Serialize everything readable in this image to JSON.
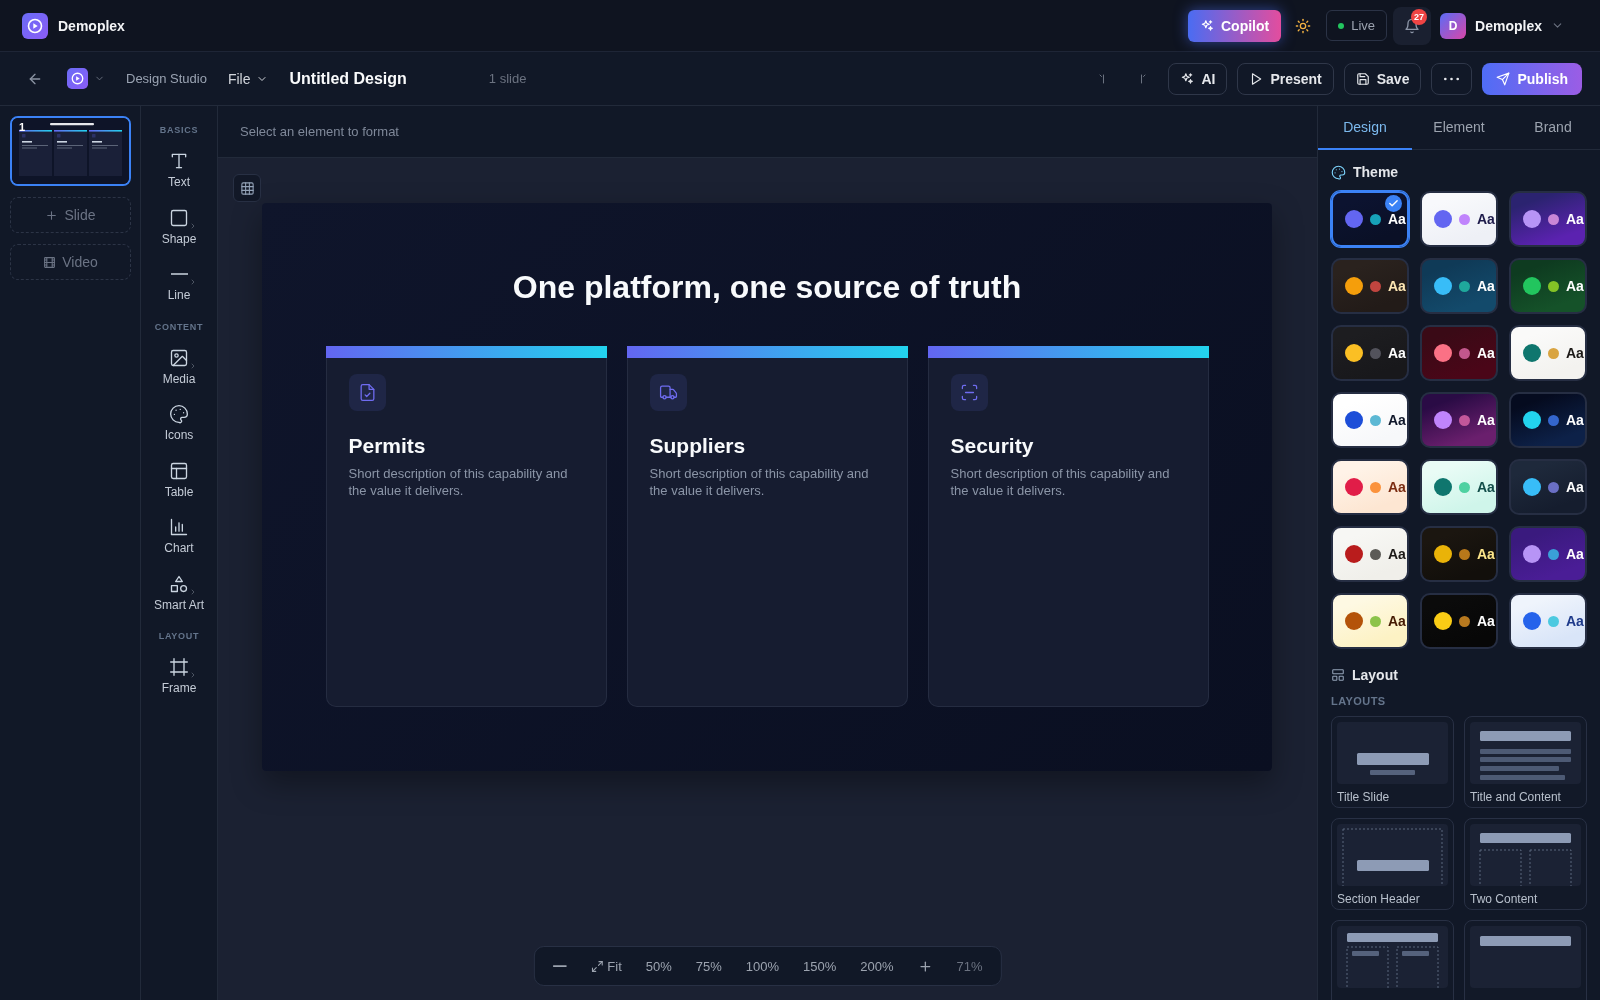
{
  "app": {
    "name": "Demoplex"
  },
  "header": {
    "copilot": "Copilot",
    "status": "Live",
    "notifications": "27",
    "user": {
      "initial": "D",
      "name": "Demoplex"
    }
  },
  "toolbar": {
    "breadcrumb": "Design Studio",
    "file_menu": "File",
    "document_title": "Untitled Design",
    "slide_count": "1 slide",
    "actions": [
      {
        "kind": "ai",
        "label": "AI"
      },
      {
        "kind": "present",
        "label": "Present"
      },
      {
        "kind": "save",
        "label": "Save"
      },
      {
        "kind": "more"
      },
      {
        "kind": "publish",
        "label": "Publish"
      }
    ]
  },
  "slides": {
    "items": [
      {
        "number": "1",
        "selected": true
      }
    ],
    "add_slide": "Slide",
    "add_video": "Video"
  },
  "tools": {
    "groups": [
      {
        "heading": "BASICS",
        "items": [
          {
            "kind": "text",
            "label": "Text",
            "submenu": false
          },
          {
            "kind": "shape",
            "label": "Shape",
            "submenu": true
          },
          {
            "kind": "line",
            "label": "Line",
            "submenu": true
          }
        ]
      },
      {
        "heading": "CONTENT",
        "items": [
          {
            "kind": "media",
            "label": "Media",
            "submenu": true
          },
          {
            "kind": "icons",
            "label": "Icons",
            "submenu": false
          },
          {
            "kind": "table",
            "label": "Table",
            "submenu": false
          },
          {
            "kind": "chart",
            "label": "Chart",
            "submenu": false
          },
          {
            "kind": "smartart",
            "label": "Smart Art",
            "submenu": true
          }
        ]
      },
      {
        "heading": "LAYOUT",
        "items": [
          {
            "kind": "frame",
            "label": "Frame",
            "submenu": true
          }
        ]
      }
    ]
  },
  "format_bar": {
    "hint": "Select an element to format"
  },
  "slide": {
    "title": "One platform, one source of truth",
    "cards": [
      {
        "kind": "document",
        "title": "Permits",
        "description": "Short description of this capability and the value it delivers."
      },
      {
        "kind": "truck",
        "title": "Suppliers",
        "description": "Short description of this capability and the value it delivers."
      },
      {
        "kind": "scan",
        "title": "Security",
        "description": "Short description of this capability and the value it delivers."
      }
    ]
  },
  "zoom_bar": {
    "controls": [
      {
        "kind": "out"
      },
      {
        "kind": "fit",
        "label": "Fit"
      },
      {
        "kind": "preset",
        "label": "50%"
      },
      {
        "kind": "preset",
        "label": "75%"
      },
      {
        "kind": "preset",
        "label": "100%"
      },
      {
        "kind": "preset",
        "label": "150%"
      },
      {
        "kind": "preset",
        "label": "200%"
      },
      {
        "kind": "in"
      }
    ],
    "current": "71%"
  },
  "inspector": {
    "tabs": [
      {
        "label": "Design",
        "selected": true
      },
      {
        "label": "Element",
        "selected": false
      },
      {
        "label": "Brand",
        "selected": false
      }
    ],
    "theme": {
      "heading": "Theme",
      "themes": [
        {
          "selected": true,
          "gradient": [
            {
              "color": "#0c1330"
            },
            {
              "color": "#0a1026"
            }
          ],
          "label": {
            "text": "Aa",
            "color": "#ffffff"
          },
          "dots": [
            {
              "color": "#6366f1"
            },
            {
              "color": "#17a2b8"
            }
          ]
        },
        {
          "selected": false,
          "gradient": [
            {
              "color": "#f8f9fc"
            },
            {
              "color": "#eef0f6"
            }
          ],
          "label": {
            "text": "Aa",
            "color": "#1e1b4b"
          },
          "dots": [
            {
              "color": "#6366f1"
            },
            {
              "color": "#c084fc"
            }
          ]
        },
        {
          "selected": false,
          "gradient": [
            {
              "color": "#2b2370"
            },
            {
              "color": "#5b22b0"
            }
          ],
          "label": {
            "text": "Aa",
            "color": "#ffffff"
          },
          "dots": [
            {
              "color": "#b794f6"
            },
            {
              "color": "#c986d6"
            }
          ]
        },
        {
          "selected": false,
          "gradient": [
            {
              "color": "#2a221e"
            },
            {
              "color": "#221b18"
            }
          ],
          "label": {
            "text": "Aa",
            "color": "#fde7b4"
          },
          "dots": [
            {
              "color": "#f59e0b"
            },
            {
              "color": "#c0453f"
            }
          ]
        },
        {
          "selected": false,
          "gradient": [
            {
              "color": "#0f3a57"
            },
            {
              "color": "#134a6b"
            }
          ],
          "label": {
            "text": "Aa",
            "color": "#ffffff"
          },
          "dots": [
            {
              "color": "#38bdf8"
            },
            {
              "color": "#1fa89c"
            }
          ]
        },
        {
          "selected": false,
          "gradient": [
            {
              "color": "#0e3b20"
            },
            {
              "color": "#155229"
            }
          ],
          "label": {
            "text": "Aa",
            "color": "#ffffff"
          },
          "dots": [
            {
              "color": "#22c55e"
            },
            {
              "color": "#84c226"
            }
          ]
        },
        {
          "selected": false,
          "gradient": [
            {
              "color": "#1d1d20"
            },
            {
              "color": "#18181b"
            }
          ],
          "label": {
            "text": "Aa",
            "color": "#ffffff"
          },
          "dots": [
            {
              "color": "#fbbf24"
            },
            {
              "color": "#52525b"
            }
          ]
        },
        {
          "selected": false,
          "gradient": [
            {
              "color": "#3a0a16"
            },
            {
              "color": "#4a0618"
            }
          ],
          "label": {
            "text": "Aa",
            "color": "#ffffff"
          },
          "dots": [
            {
              "color": "#fb7185"
            },
            {
              "color": "#c2578c"
            }
          ]
        },
        {
          "selected": false,
          "gradient": [
            {
              "color": "#fafaf9"
            },
            {
              "color": "#f3f2ef"
            }
          ],
          "label": {
            "text": "Aa",
            "color": "#1c1917"
          },
          "dots": [
            {
              "color": "#0f766e"
            },
            {
              "color": "#d9a441"
            }
          ]
        },
        {
          "selected": false,
          "gradient": [
            {
              "color": "#ffffff"
            },
            {
              "color": "#f7f8fa"
            }
          ],
          "label": {
            "text": "Aa",
            "color": "#0f172a"
          },
          "dots": [
            {
              "color": "#1d4ed8"
            },
            {
              "color": "#5cb8d4"
            }
          ]
        },
        {
          "selected": false,
          "gradient": [
            {
              "color": "#2a0b45"
            },
            {
              "color": "#6a1f6d"
            }
          ],
          "label": {
            "text": "Aa",
            "color": "#ffffff"
          },
          "dots": [
            {
              "color": "#c084fc"
            },
            {
              "color": "#c2579a"
            }
          ]
        },
        {
          "selected": false,
          "gradient": [
            {
              "color": "#050b1f"
            },
            {
              "color": "#0d2148"
            }
          ],
          "label": {
            "text": "Aa",
            "color": "#ffffff"
          },
          "dots": [
            {
              "color": "#22d3ee"
            },
            {
              "color": "#3466cc"
            }
          ]
        },
        {
          "selected": false,
          "gradient": [
            {
              "color": "#fff3e8"
            },
            {
              "color": "#fde6d2"
            }
          ],
          "label": {
            "text": "Aa",
            "color": "#7c2d12"
          },
          "dots": [
            {
              "color": "#e11d48"
            },
            {
              "color": "#fb923c"
            }
          ]
        },
        {
          "selected": false,
          "gradient": [
            {
              "color": "#e9fcf6"
            },
            {
              "color": "#cff5ea"
            }
          ],
          "label": {
            "text": "Aa",
            "color": "#134e4a"
          },
          "dots": [
            {
              "color": "#0f766e"
            },
            {
              "color": "#4ed1a1"
            }
          ]
        },
        {
          "selected": false,
          "gradient": [
            {
              "color": "#1e293b"
            },
            {
              "color": "#151d2e"
            }
          ],
          "label": {
            "text": "Aa",
            "color": "#ffffff"
          },
          "dots": [
            {
              "color": "#38bdf8"
            },
            {
              "color": "#6a6fc4"
            }
          ]
        },
        {
          "selected": false,
          "gradient": [
            {
              "color": "#f7f7f4"
            },
            {
              "color": "#f0efea"
            }
          ],
          "label": {
            "text": "Aa",
            "color": "#1c1917"
          },
          "dots": [
            {
              "color": "#b91c1c"
            },
            {
              "color": "#5c5b57"
            }
          ]
        },
        {
          "selected": false,
          "gradient": [
            {
              "color": "#1b1610"
            },
            {
              "color": "#120f0b"
            }
          ],
          "label": {
            "text": "Aa",
            "color": "#fde68a"
          },
          "dots": [
            {
              "color": "#eab308"
            },
            {
              "color": "#b8781a"
            }
          ]
        },
        {
          "selected": false,
          "gradient": [
            {
              "color": "#3a1a7e"
            },
            {
              "color": "#4a1d96"
            }
          ],
          "label": {
            "text": "Aa",
            "color": "#ffffff"
          },
          "dots": [
            {
              "color": "#b794f6"
            },
            {
              "color": "#3aa0d8"
            }
          ]
        },
        {
          "selected": false,
          "gradient": [
            {
              "color": "#fef9e3"
            },
            {
              "color": "#fdf2c4"
            }
          ],
          "label": {
            "text": "Aa",
            "color": "#451a03"
          },
          "dots": [
            {
              "color": "#b45309"
            },
            {
              "color": "#8cc34a"
            }
          ]
        },
        {
          "selected": false,
          "gradient": [
            {
              "color": "#0b0b0b"
            },
            {
              "color": "#070707"
            }
          ],
          "label": {
            "text": "Aa",
            "color": "#ffffff"
          },
          "dots": [
            {
              "color": "#facc15"
            },
            {
              "color": "#b7791f"
            }
          ]
        },
        {
          "selected": false,
          "gradient": [
            {
              "color": "#eff4fc"
            },
            {
              "color": "#d9e5f8"
            }
          ],
          "label": {
            "text": "Aa",
            "color": "#1e3a8a"
          },
          "dots": [
            {
              "color": "#2563eb"
            },
            {
              "color": "#4cc9e0"
            }
          ]
        }
      ]
    },
    "layout": {
      "heading": "Layout",
      "subheading": "LAYOUTS",
      "layouts": [
        {
          "kind": "title",
          "label": "Title Slide"
        },
        {
          "kind": "content",
          "label": "Title and Content"
        },
        {
          "kind": "section",
          "label": "Section Header"
        },
        {
          "kind": "two",
          "label": "Two Content"
        },
        {
          "kind": "comparison"
        },
        {
          "kind": "heading"
        }
      ]
    }
  }
}
